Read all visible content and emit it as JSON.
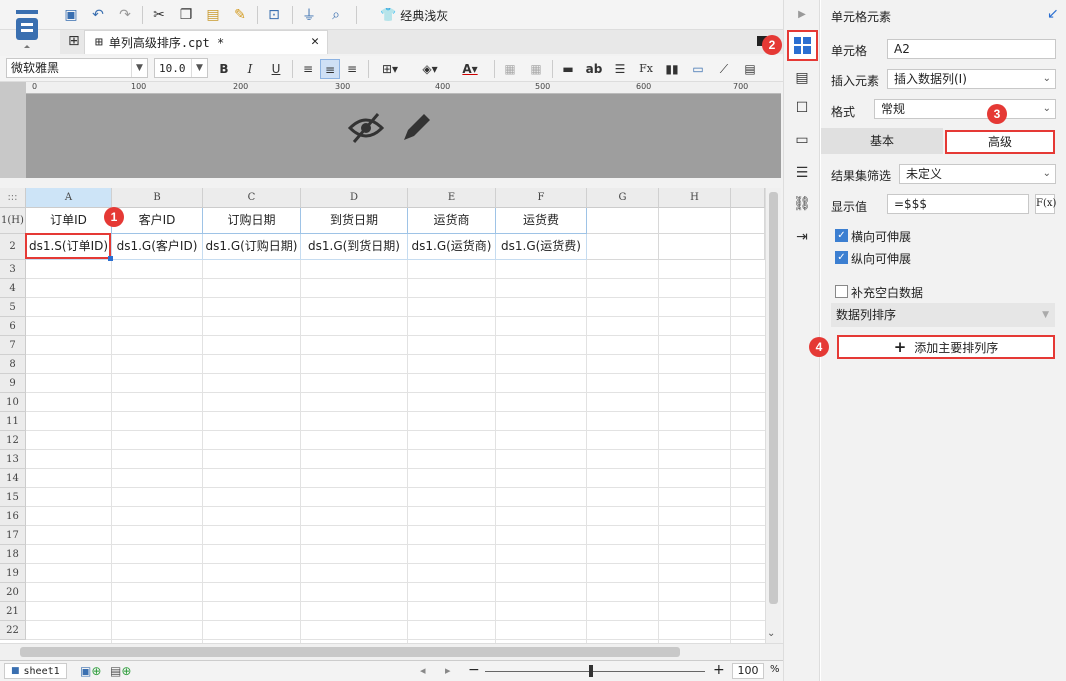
{
  "toolbar": {
    "theme_label": "经典浅灰"
  },
  "tab": {
    "title": "单列高级排序.cpt *"
  },
  "format_bar": {
    "font_name": "微软雅黑",
    "font_size": "10.0"
  },
  "ruler": {
    "ticks": [
      "0",
      "100",
      "200",
      "300",
      "400",
      "500",
      "600",
      "700"
    ]
  },
  "grid": {
    "corner": ":::",
    "columns": [
      "A",
      "B",
      "C",
      "D",
      "E",
      "F",
      "G",
      "H"
    ],
    "rows": [
      "1(H)",
      "2",
      "3",
      "4",
      "5",
      "6",
      "7",
      "8",
      "9",
      "10",
      "11",
      "12",
      "13",
      "14",
      "15",
      "16",
      "17",
      "18",
      "19",
      "20",
      "21",
      "22"
    ],
    "header_cells": [
      "订单ID",
      "客户ID",
      "订购日期",
      "到货日期",
      "运货商",
      "运货费"
    ],
    "data_cells": [
      "ds1.S(订单ID)",
      "ds1.G(客户ID)",
      "ds1.G(订购日期)",
      "ds1.G(到货日期)",
      "ds1.G(运货商)",
      "ds1.G(运货费)"
    ]
  },
  "annotations": [
    "1",
    "2",
    "3",
    "4"
  ],
  "sheetbar": {
    "sheet_name": "sheet1",
    "zoom": "100",
    "zoom_unit": "%"
  },
  "panel": {
    "title": "单元格元素",
    "cell_label": "单元格",
    "cell_value": "A2",
    "insert_label": "插入元素",
    "insert_value": "插入数据列(I)",
    "format_label": "格式",
    "format_value": "常规",
    "tab_basic": "基本",
    "tab_advanced": "高级",
    "filter_label": "结果集筛选",
    "filter_value": "未定义",
    "display_label": "显示值",
    "display_value": "=$$$",
    "fx": "F(x)",
    "h_expand": "横向可伸展",
    "v_expand": "纵向可伸展",
    "fill_blank": "补充空白数据",
    "sort_section": "数据列排序",
    "add_sort_button": "添加主要排列序"
  },
  "colors": {
    "accent": "#3c7fd1",
    "annotation_red": "#e53935",
    "header_gray": "#9e9e9e",
    "selected_col": "#cde4f7"
  }
}
